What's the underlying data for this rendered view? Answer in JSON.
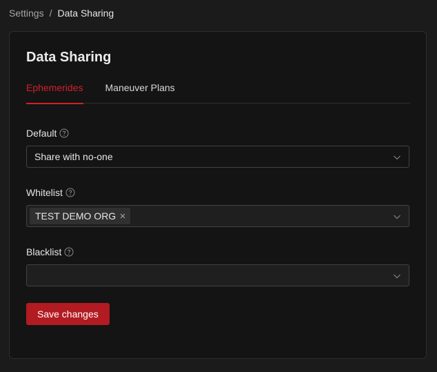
{
  "breadcrumb": {
    "root": "Settings",
    "separator": "/",
    "current": "Data Sharing"
  },
  "card": {
    "title": "Data Sharing",
    "tabs": [
      {
        "label": "Ephemerides",
        "active": true
      },
      {
        "label": "Maneuver Plans",
        "active": false
      }
    ]
  },
  "form": {
    "default": {
      "label": "Default",
      "value": "Share with no-one"
    },
    "whitelist": {
      "label": "Whitelist",
      "tags": [
        "TEST DEMO ORG"
      ]
    },
    "blacklist": {
      "label": "Blacklist",
      "value": ""
    },
    "save_label": "Save changes"
  },
  "icons": {
    "help": "question-circle-icon",
    "chevron": "chevron-down-icon",
    "tag_close": "close-icon"
  },
  "colors": {
    "accent": "#d32029",
    "button": "#b31b22",
    "background": "#1b1b1b",
    "card": "#141414"
  }
}
